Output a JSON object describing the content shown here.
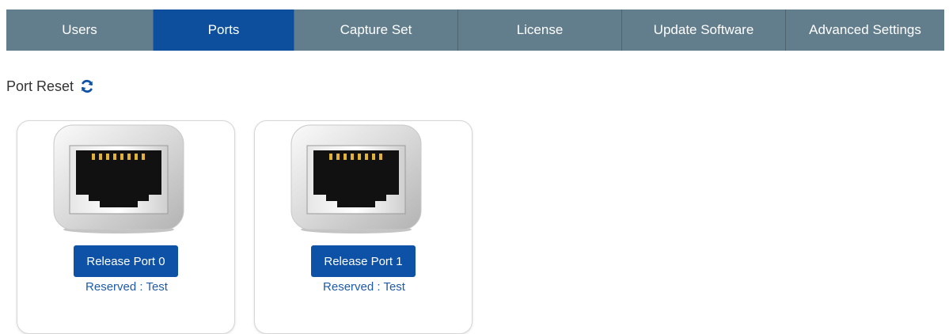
{
  "tabs": [
    {
      "label": "Users",
      "active": false
    },
    {
      "label": "Ports",
      "active": true
    },
    {
      "label": "Capture Set",
      "active": false
    },
    {
      "label": "License",
      "active": false
    },
    {
      "label": "Update Software",
      "active": false
    },
    {
      "label": "Advanced Settings",
      "active": false
    }
  ],
  "section": {
    "title": "Port Reset",
    "refresh_icon": "refresh-icon"
  },
  "ports": [
    {
      "button_label": "Release Port 0",
      "reserved_text": "Reserved : Test",
      "icon": "ethernet-port-icon"
    },
    {
      "button_label": "Release Port 1",
      "reserved_text": "Reserved : Test",
      "icon": "ethernet-port-icon"
    }
  ],
  "colors": {
    "tab_background": "#627d8b",
    "tab_active": "#0d4f9c",
    "button": "#0d52a6",
    "reserved_text": "#1e5ba8"
  }
}
